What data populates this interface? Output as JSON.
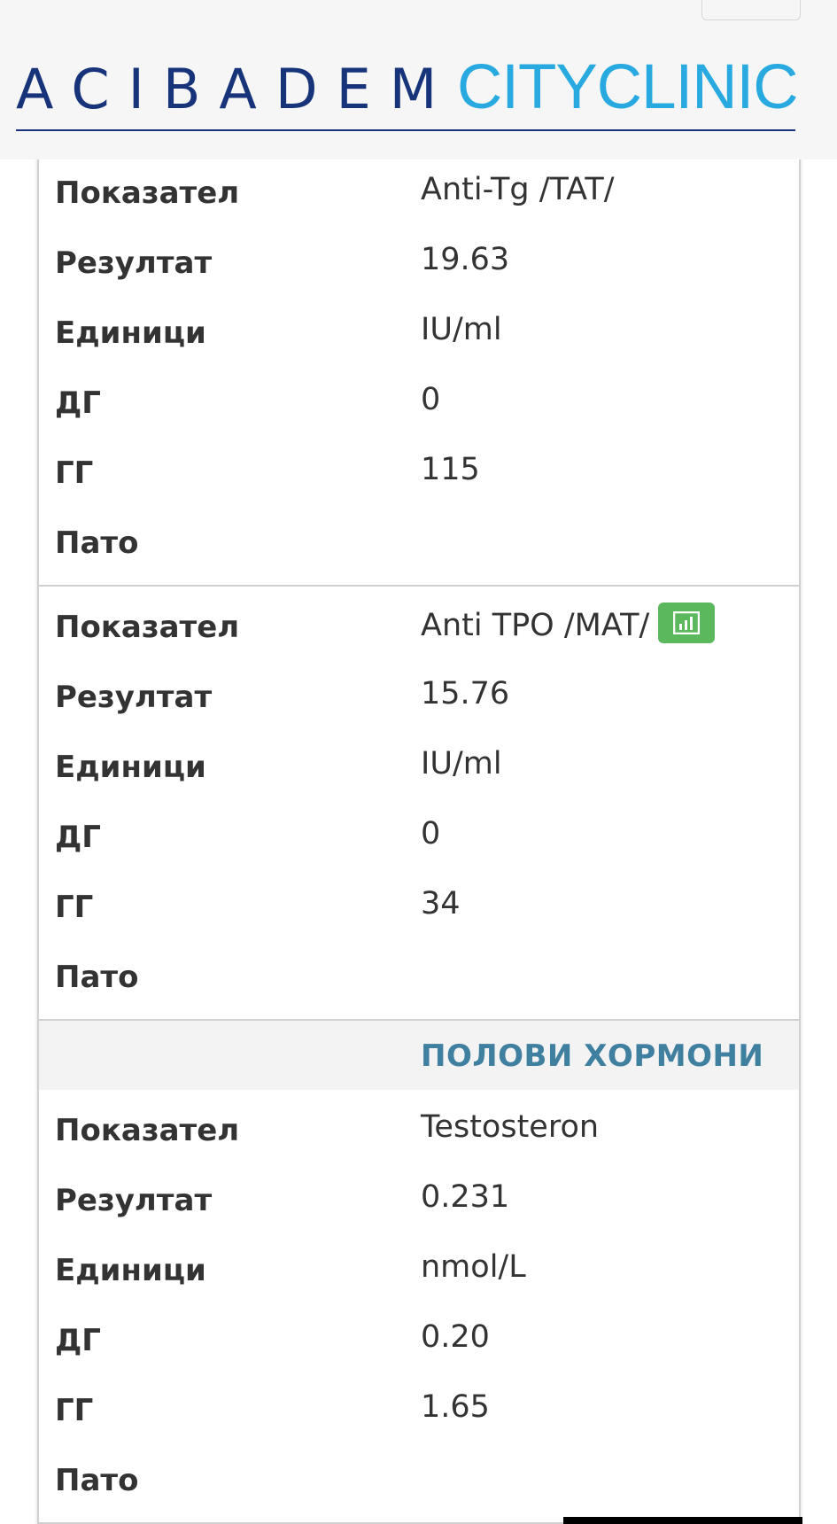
{
  "header": {
    "logo_left": "ACIBADEM",
    "logo_right": "CITYCLINIC",
    "brand_color_dark": "#17337a",
    "brand_color_light": "#28a9df"
  },
  "labels": {
    "indicator": "Показател",
    "result": "Резултат",
    "units": "Единици",
    "lower": "ДГ",
    "upper": "ГГ",
    "patho": "Пато"
  },
  "tests": [
    {
      "indicator": "Anti-Tg /TAT/",
      "result": "19.63",
      "units": "IU/ml",
      "lower": "0",
      "upper": "115",
      "patho": ""
    },
    {
      "indicator": "Anti TPO /MAT/",
      "result": "15.76",
      "units": "IU/ml",
      "lower": "0",
      "upper": "34",
      "patho": "",
      "has_chart_button": true,
      "chart_icon": "bar-chart-icon"
    }
  ],
  "section": {
    "title": "ПОЛОВИ ХОРМОНИ"
  },
  "section_tests": [
    {
      "indicator": "Testosteron",
      "result": "0.231",
      "units": "nmol/L",
      "lower": "0.20",
      "upper": "1.65",
      "patho": ""
    }
  ],
  "colors": {
    "chart_button": "#5cb85c",
    "section_title": "#3f7f9f"
  }
}
